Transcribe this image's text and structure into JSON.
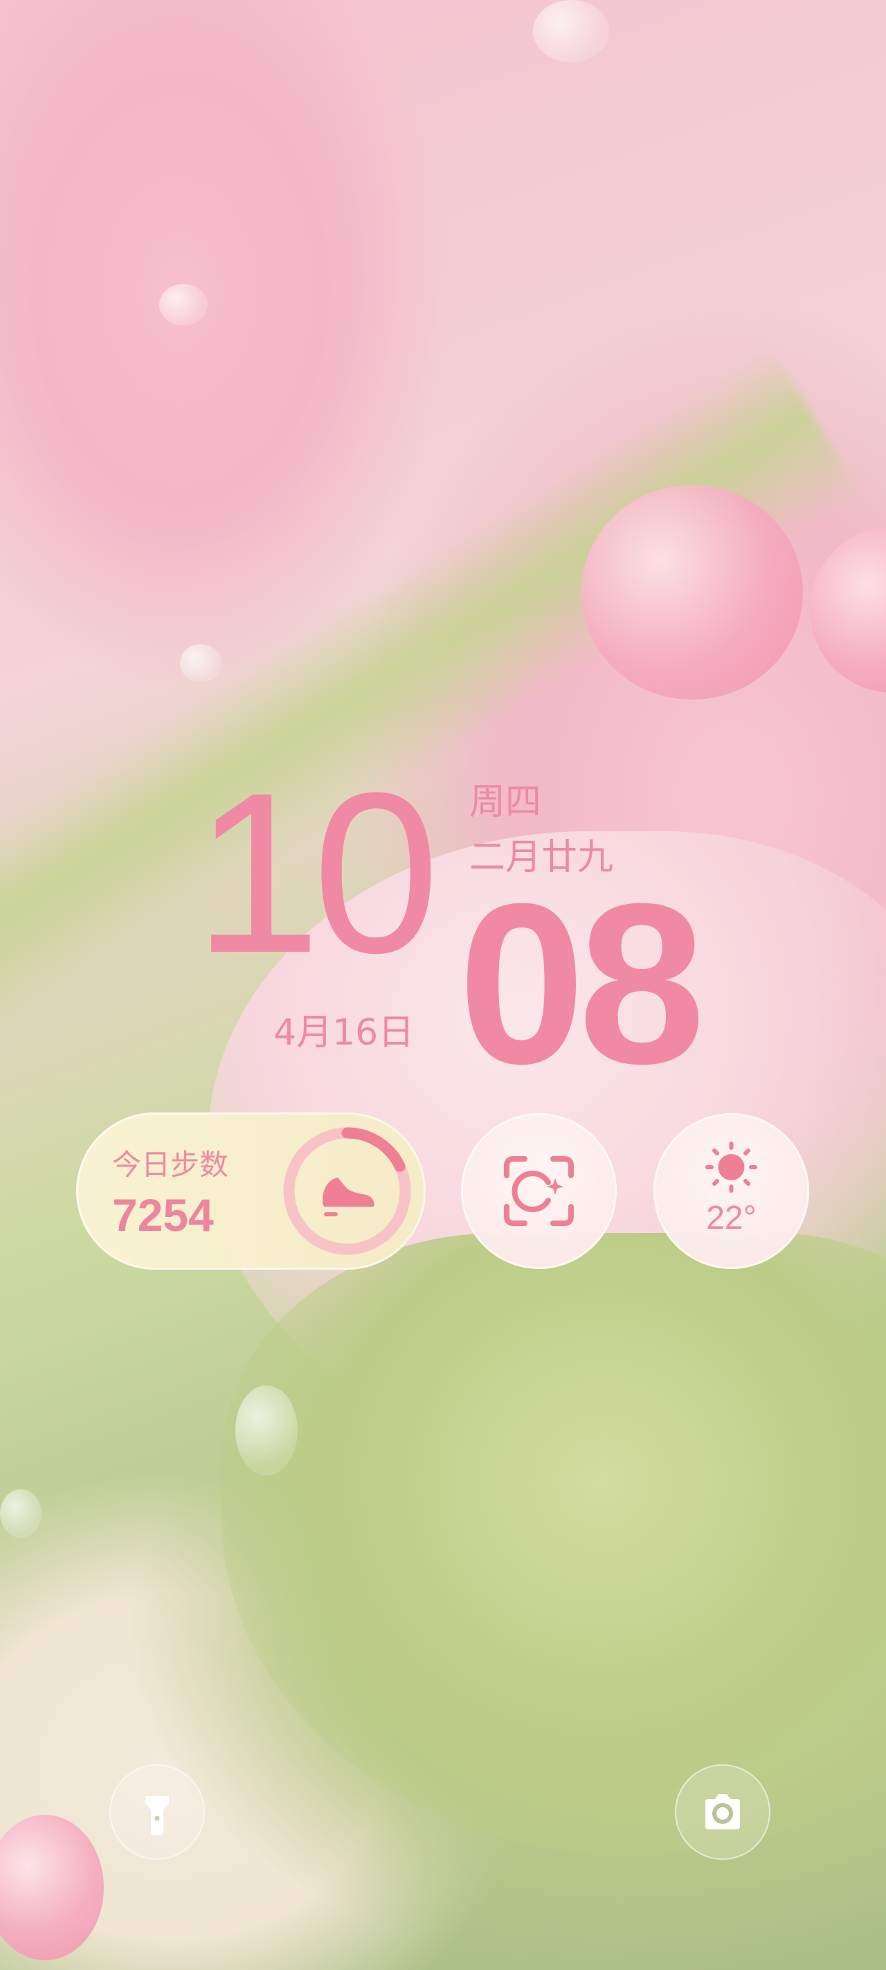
{
  "clock": {
    "hour": "10",
    "minute": "08",
    "weekday": "周四",
    "lunar_date": "二月廿九",
    "date": "4月16日"
  },
  "steps_widget": {
    "title": "今日步数",
    "value": "7254",
    "icon": "shoe-icon"
  },
  "scan_widget": {
    "icon": "scan-icon"
  },
  "weather_widget": {
    "icon": "sun-icon",
    "temperature": "22°"
  },
  "shortcuts": {
    "left_icon": "flashlight-icon",
    "right_icon": "camera-icon"
  },
  "colors": {
    "accent": "#f08aa4",
    "steps_ring_track": "#f7c3c7",
    "steps_ring_fill": "#ef7f94"
  }
}
